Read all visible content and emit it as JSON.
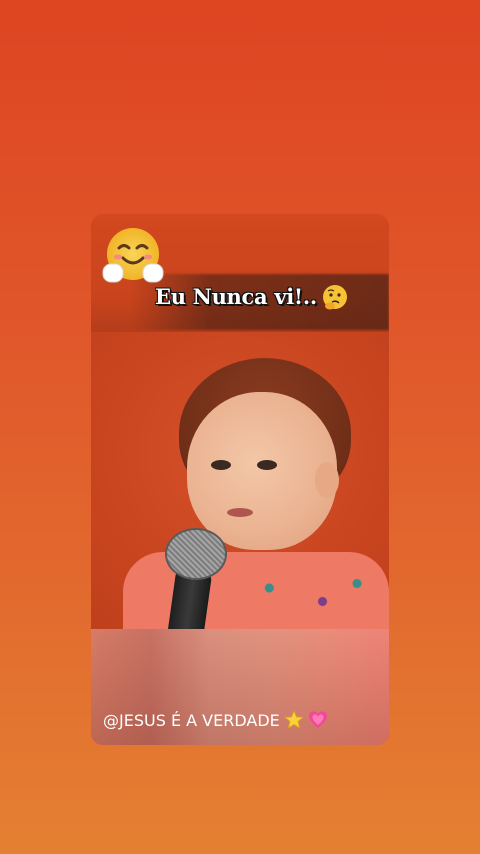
{
  "overlay": {
    "caption": "Eu Nunca vi!..",
    "caption_emoji": "thinking-face-icon",
    "corner_emoji": "smiling-face-with-open-hands-icon"
  },
  "footer": {
    "handle": "@JESUS É A VERDADE",
    "emoji_1": "star-icon",
    "emoji_2": "growing-heart-icon"
  },
  "colors": {
    "background_top": "#de4522",
    "background_bottom": "#e48032",
    "card_accent": "#c9451f"
  }
}
